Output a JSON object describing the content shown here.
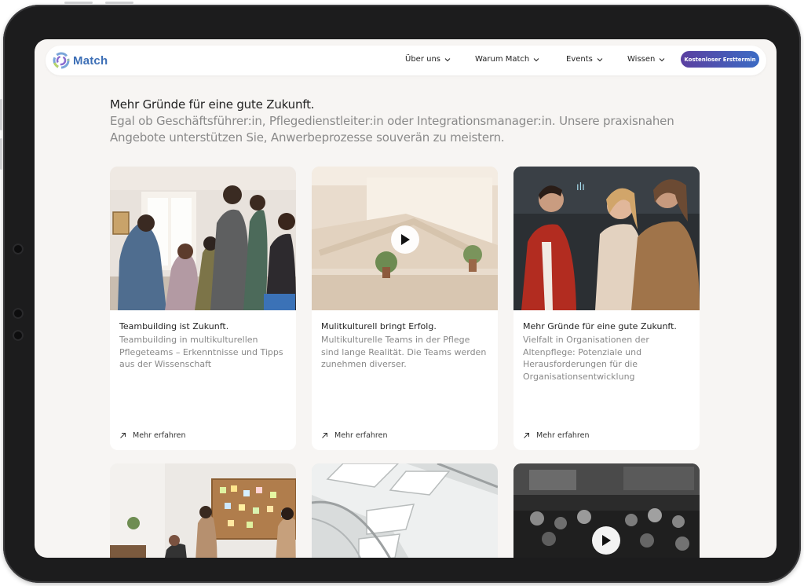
{
  "brand": {
    "name": "Match"
  },
  "nav": {
    "items": [
      {
        "label": "Über uns"
      },
      {
        "label": "Warum Match"
      },
      {
        "label": "Events"
      },
      {
        "label": "Wissen"
      }
    ],
    "cta_label": "Kostenloser Ersttermin"
  },
  "intro": {
    "heading": "Mehr Gründe für eine gute Zukunft.",
    "subheading": "Egal ob Geschäftsführer:in, Pflegedienstleiter:in oder Integrationsmanager:in. Unsere praxisnahen Angebote unterstützen Sie, Anwerbeprozesse souverän zu meistern."
  },
  "cards": [
    {
      "title": "Teambuilding ist Zukunft.",
      "text": "Teambuilding in multikulturellen Pflegeteams – Erkenntnisse und Tipps aus der Wissenschaft",
      "link": "Mehr erfahren",
      "image": "team-meeting-photo"
    },
    {
      "title": "Mulitkulturell bringt Erfolg.",
      "text": "Multikulturelle Teams in der Pflege sind lange Realität. Die Teams werden zunehmen diverser.",
      "link": "Mehr erfahren",
      "image": "bright-staircase-video"
    },
    {
      "title": "Mehr Gründe für eine gute Zukunft.",
      "text": "Vielfalt in Organisationen der Altenpflege: Potenziale und Herausforderungen für die Organisationsentwicklung",
      "link": "Mehr erfahren",
      "image": "people-talking-photo"
    },
    {
      "image": "pinboard-meeting-photo"
    },
    {
      "image": "skylight-architecture-photo"
    },
    {
      "image": "black-white-crowd-video"
    }
  ],
  "colors": {
    "brand_blue": "#3d6fb6",
    "cta_start": "#5b3fa0",
    "cta_end": "#3b6bc4",
    "page_bg": "#f7f5f3"
  }
}
